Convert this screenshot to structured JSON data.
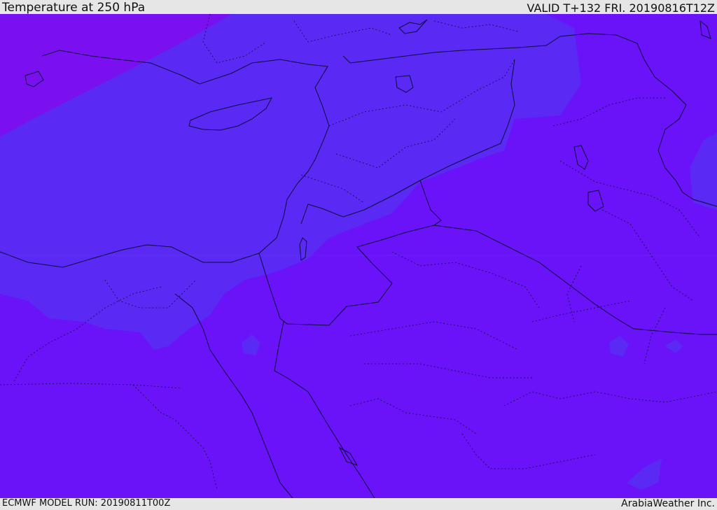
{
  "header": {
    "title": "Temperature at 250 hPa",
    "valid": "VALID T+132 FRI. 20190816T12Z"
  },
  "footer": {
    "model_run": "ECMWF MODEL RUN: 20190811T00Z",
    "credit": "ArabiaWeather Inc."
  },
  "colors": {
    "background": "#6a12f8",
    "cool_band": "#5a2af4",
    "warm_band": "#7a0ff0",
    "border_line": "#0b0c3a"
  }
}
